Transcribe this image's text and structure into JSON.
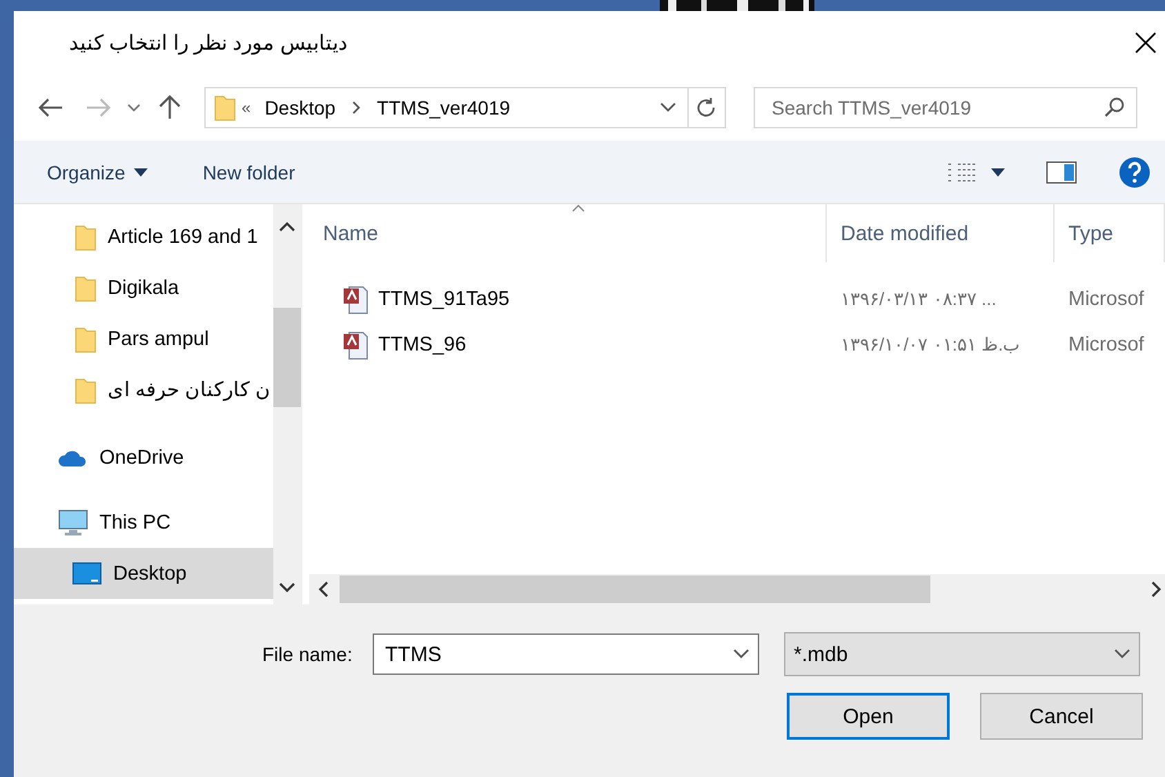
{
  "window": {
    "title": "دیتابیس مورد نظر را انتخاب کنید"
  },
  "address": {
    "overflow": "«",
    "segments": [
      "Desktop",
      "TTMS_ver4019"
    ]
  },
  "search": {
    "placeholder": "Search TTMS_ver4019"
  },
  "toolbar": {
    "organize": "Organize",
    "new_folder": "New folder"
  },
  "sidebar": {
    "items": [
      {
        "label": "Article 169 and 1",
        "kind": "folder",
        "selected": false
      },
      {
        "label": "Digikala",
        "kind": "folder",
        "selected": false
      },
      {
        "label": "Pars ampul",
        "kind": "folder",
        "selected": false
      },
      {
        "label": "ن کارکنان حرفه ای",
        "kind": "folder",
        "selected": false
      },
      {
        "label": "OneDrive",
        "kind": "cloud",
        "selected": false
      },
      {
        "label": "This PC",
        "kind": "pc",
        "selected": false
      },
      {
        "label": "Desktop",
        "kind": "desktop",
        "selected": true
      }
    ]
  },
  "table": {
    "columns": [
      "Name",
      "Date modified",
      "Type"
    ],
    "rows": [
      {
        "name": "TTMS_91Ta95",
        "date": "۱۳۹۶/۰۳/۱۳ ۰۸:۳۷ ...",
        "type": "Microsof"
      },
      {
        "name": "TTMS_96",
        "date": "۱۳۹۶/۱۰/۰۷ ب.ظ ۰۱:۵۱",
        "type": "Microsof"
      }
    ]
  },
  "file_name": {
    "label": "File name:",
    "value": "TTMS"
  },
  "filter": {
    "value": "*.mdb"
  },
  "buttons": [
    {
      "label": "Open",
      "default": true
    },
    {
      "label": "Cancel",
      "default": false
    }
  ]
}
